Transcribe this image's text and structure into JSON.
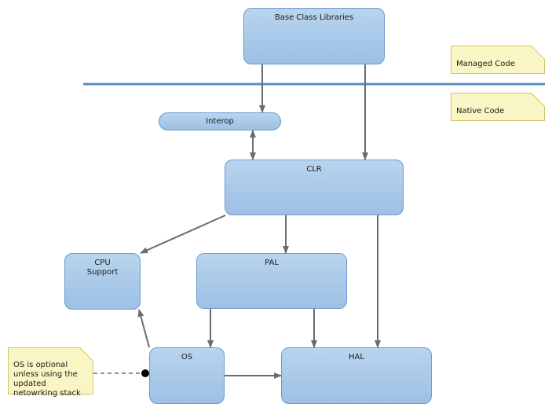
{
  "diagram": {
    "nodes": [
      {
        "id": "bcl",
        "label": "Base Class Libraries"
      },
      {
        "id": "interop",
        "label": "Interop"
      },
      {
        "id": "clr",
        "label": "CLR"
      },
      {
        "id": "cpu",
        "label": "CPU\nSupport"
      },
      {
        "id": "pal",
        "label": "PAL"
      },
      {
        "id": "os",
        "label": "OS"
      },
      {
        "id": "hal",
        "label": "HAL"
      }
    ],
    "notes": [
      {
        "id": "managed",
        "text": "Managed Code"
      },
      {
        "id": "native",
        "text": "Native Code"
      },
      {
        "id": "os-note",
        "text": "OS is optional\nunless using the\nupdated\nnetowrking stack"
      }
    ],
    "edges": [
      {
        "from": "bcl",
        "to": "interop",
        "type": "arrow"
      },
      {
        "from": "bcl",
        "to": "clr",
        "type": "arrow"
      },
      {
        "from": "interop",
        "to": "clr",
        "type": "bidirectional"
      },
      {
        "from": "clr",
        "to": "cpu",
        "type": "arrow"
      },
      {
        "from": "clr",
        "to": "pal",
        "type": "arrow"
      },
      {
        "from": "clr",
        "to": "hal",
        "type": "arrow"
      },
      {
        "from": "pal",
        "to": "os",
        "type": "arrow"
      },
      {
        "from": "pal",
        "to": "hal",
        "type": "arrow"
      },
      {
        "from": "os",
        "to": "hal",
        "type": "arrow"
      },
      {
        "from": "os",
        "to": "cpu",
        "type": "arrow"
      },
      {
        "from": "os-note",
        "to": "os",
        "type": "dashed-anchor"
      }
    ],
    "colors": {
      "node_fill": "#aecbea",
      "node_border": "#6d9acb",
      "separator": "#5b8cc0",
      "edge": "#6b6b6b",
      "note_fill": "#faf5c4",
      "note_border": "#d4c56a"
    }
  }
}
